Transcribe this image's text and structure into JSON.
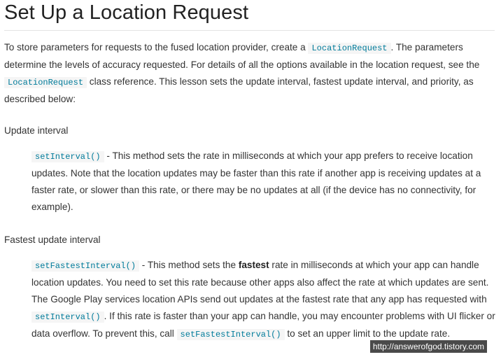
{
  "title": "Set Up a Location Request",
  "intro": {
    "t1": "To store parameters for requests to the fused location provider, create a ",
    "code1": "LocationRequest",
    "t2": ". The parameters determine the levels of accuracy requested. For details of all the options available in the location request, see the ",
    "code2": "LocationRequest",
    "t3": " class reference. This lesson sets the update interval, fastest update interval, and priority, as described below:"
  },
  "update_interval": {
    "heading": "Update interval",
    "code": "setInterval()",
    "text": " - This method sets the rate in milliseconds at which your app prefers to receive location updates. Note that the location updates may be faster than this rate if another app is receiving updates at a faster rate, or slower than this rate, or there may be no updates at all (if the device has no connectivity, for example)."
  },
  "fastest_interval": {
    "heading": "Fastest update interval",
    "code1": "setFastestInterval()",
    "t1": " - This method sets the ",
    "bold": "fastest",
    "t2": " rate in milliseconds at which your app can handle location updates. You need to set this rate because other apps also affect the rate at which updates are sent. The Google Play services location APIs send out updates at the fastest rate that any app has requested with ",
    "code2": "setInterval()",
    "t3": ". If this rate is faster than your app can handle, you may encounter problems with UI flicker or data overflow. To prevent this, call ",
    "code3": "setFastestInterval()",
    "t4": " to set an upper limit to the update rate."
  },
  "watermark": "http://answerofgod.tistory.com"
}
